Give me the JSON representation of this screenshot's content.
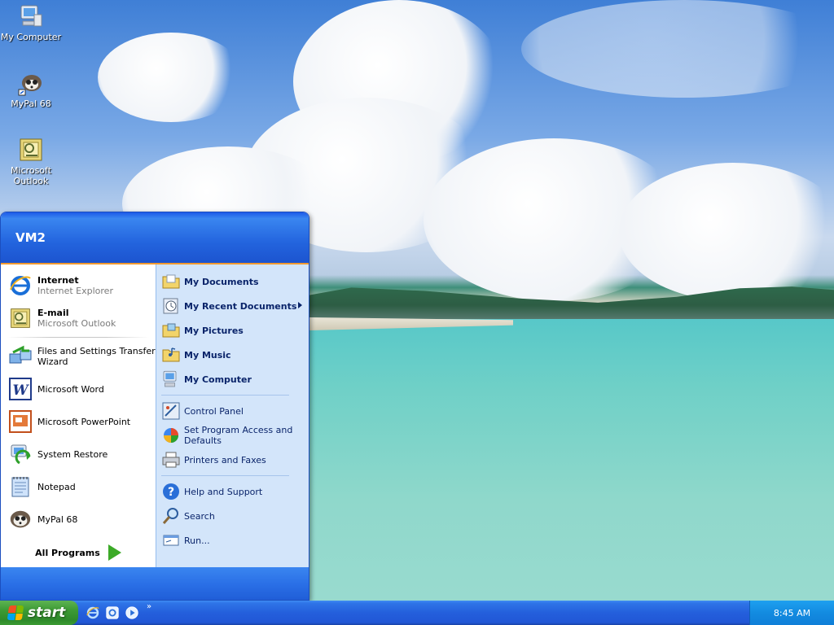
{
  "desktop": {
    "icons": [
      {
        "label": "My Computer",
        "icon": "my-computer-icon"
      },
      {
        "label": "MyPal 68",
        "icon": "mypal-icon"
      },
      {
        "label": "Microsoft Outlook",
        "icon": "outlook-icon"
      }
    ]
  },
  "start_menu": {
    "user": "VM2",
    "left_items": [
      {
        "title": "Internet",
        "subtitle": "Internet Explorer",
        "icon": "internet-explorer-icon",
        "pinned": true
      },
      {
        "title": "E-mail",
        "subtitle": "Microsoft Outlook",
        "icon": "outlook-icon",
        "pinned": true
      },
      {
        "title": "Files and Settings Transfer Wizard",
        "icon": "transfer-wizard-icon"
      },
      {
        "title": "Microsoft Word",
        "icon": "word-icon"
      },
      {
        "title": "Microsoft PowerPoint",
        "icon": "powerpoint-icon"
      },
      {
        "title": "System Restore",
        "icon": "system-restore-icon"
      },
      {
        "title": "Notepad",
        "icon": "notepad-icon"
      },
      {
        "title": "MyPal 68",
        "icon": "mypal-icon"
      }
    ],
    "all_programs": "All Programs",
    "right_items": [
      {
        "label": "My Documents",
        "icon": "folder-documents-icon",
        "bold": true
      },
      {
        "label": "My Recent Documents",
        "icon": "recent-documents-icon",
        "bold": true,
        "submenu": true
      },
      {
        "label": "My Pictures",
        "icon": "folder-pictures-icon",
        "bold": true
      },
      {
        "label": "My Music",
        "icon": "folder-music-icon",
        "bold": true
      },
      {
        "label": "My Computer",
        "icon": "my-computer-icon",
        "bold": true
      },
      {
        "label": "Control Panel",
        "icon": "control-panel-icon"
      },
      {
        "label": "Set Program Access and Defaults",
        "icon": "program-access-icon"
      },
      {
        "label": "Printers and Faxes",
        "icon": "printer-icon"
      },
      {
        "label": "Help and Support",
        "icon": "help-icon"
      },
      {
        "label": "Search",
        "icon": "search-icon"
      },
      {
        "label": "Run...",
        "icon": "run-icon"
      }
    ]
  },
  "taskbar": {
    "start_label": "start",
    "quick_launch": [
      "internet-explorer-icon",
      "outlook-express-icon",
      "media-player-icon"
    ],
    "quick_launch_more": "»",
    "clock": "8:45 AM"
  }
}
